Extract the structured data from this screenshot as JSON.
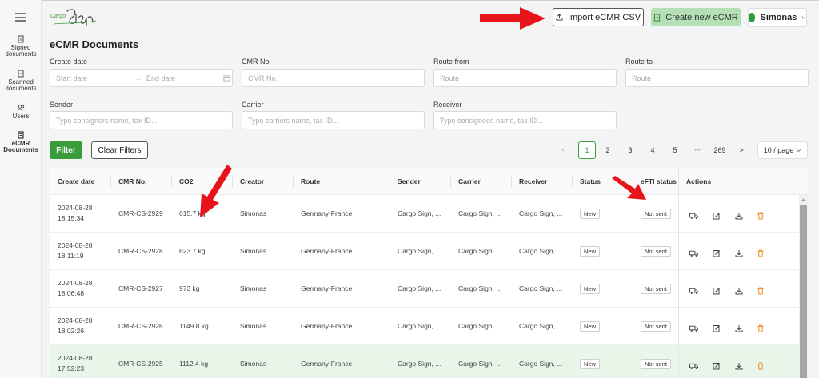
{
  "sidebar": {
    "items": [
      {
        "label1": "Signed",
        "label2": "documents"
      },
      {
        "label1": "Scanned",
        "label2": "documents"
      },
      {
        "label1": "Users",
        "label2": ""
      },
      {
        "label1": "eCMR",
        "label2": "Documents"
      }
    ]
  },
  "header": {
    "logo_text": "Cargo Sign",
    "import_label": "Import eCMR CSV",
    "create_label": "Create new eCMR",
    "user_name": "Simonas"
  },
  "page": {
    "title": "eCMR Documents"
  },
  "filters": {
    "create_date_label": "Create date",
    "start_date_placeholder": "Start date",
    "end_date_placeholder": "End date",
    "cmr_no_label": "CMR No.",
    "cmr_no_placeholder": "CMR No.",
    "route_from_label": "Route from",
    "route_from_placeholder": "Route",
    "route_to_label": "Route to",
    "route_to_placeholder": "Route",
    "sender_label": "Sender",
    "sender_placeholder": "Type consignors name, tax ID...",
    "carrier_label": "Carrier",
    "carrier_placeholder": "Type carriers name, tax ID...",
    "receiver_label": "Receiver",
    "receiver_placeholder": "Type consignees name, tax ID...",
    "filter_button": "Filter",
    "clear_button": "Clear Filters"
  },
  "pagination": {
    "prev": "<",
    "pages": [
      "1",
      "2",
      "3",
      "4",
      "5"
    ],
    "ellipsis": "•••",
    "last": "269",
    "next": ">",
    "page_size": "10 / page"
  },
  "table": {
    "columns": [
      "Create date",
      "CMR No.",
      "CO2",
      "Creator",
      "Route",
      "Sender",
      "Carrier",
      "Receiver",
      "Status",
      "eFTI status",
      "Actions"
    ],
    "rows": [
      {
        "date": "2024-08-28",
        "time": "18:15:34",
        "cmr": "CMR-CS-2929",
        "co2": "615.7 kg",
        "creator": "Simonas",
        "route": "Germany-France",
        "sender": "Cargo Sign, ...",
        "carrier": "Cargo Sign, ...",
        "receiver": "Cargo Sign, ...",
        "status": "New",
        "efti": "Not sent"
      },
      {
        "date": "2024-08-28",
        "time": "18:11:19",
        "cmr": "CMR-CS-2928",
        "co2": "623.7 kg",
        "creator": "Simonas",
        "route": "Germany-France",
        "sender": "Cargo Sign, ...",
        "carrier": "Cargo Sign, ...",
        "receiver": "Cargo Sign, ...",
        "status": "New",
        "efti": "Not sent"
      },
      {
        "date": "2024-08-28",
        "time": "18:06:48",
        "cmr": "CMR-CS-2927",
        "co2": "973 kg",
        "creator": "Simonas",
        "route": "Germany-France",
        "sender": "Cargo Sign, ...",
        "carrier": "Cargo Sign, ...",
        "receiver": "Cargo Sign, ...",
        "status": "New",
        "efti": "Not sent"
      },
      {
        "date": "2024-08-28",
        "time": "18:02:26",
        "cmr": "CMR-CS-2926",
        "co2": "1149.8 kg",
        "creator": "Simonas",
        "route": "Germany-France",
        "sender": "Cargo Sign, ...",
        "carrier": "Cargo Sign, ...",
        "receiver": "Cargo Sign, ...",
        "status": "New",
        "efti": "Not sent"
      },
      {
        "date": "2024-08-28",
        "time": "17:52:23",
        "cmr": "CMR-CS-2925",
        "co2": "1112.4 kg",
        "creator": "Simonas",
        "route": "Germany-France",
        "sender": "Cargo Sign, ...",
        "carrier": "Cargo Sign, ...",
        "receiver": "Cargo Sign, ...",
        "status": "New",
        "efti": "Not sent"
      }
    ]
  },
  "colors": {
    "accent_green": "#3a9b3a",
    "create_button": "#b5e0b5",
    "delete_icon": "#f0922e",
    "annotation_arrow": "#e8141b"
  },
  "icons": [
    "menu-icon",
    "document-icon",
    "scan-icon",
    "users-icon",
    "ecmr-icon",
    "upload-icon",
    "plus-doc-icon",
    "chevron-down-icon",
    "calendar-icon",
    "truck-icon",
    "edit-icon",
    "download-icon",
    "trash-icon"
  ]
}
